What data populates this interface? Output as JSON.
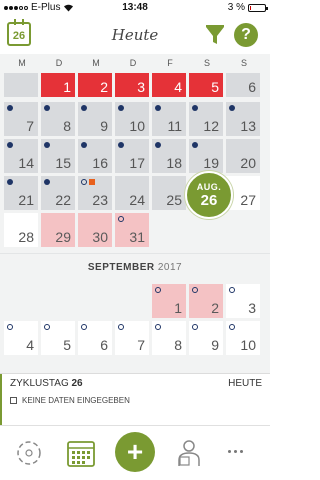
{
  "status_bar": {
    "carrier": "E-Plus",
    "time": "13:48",
    "battery": "3 %"
  },
  "header": {
    "calendar_day": "26",
    "title": "Heute"
  },
  "weekdays": [
    "M",
    "D",
    "M",
    "D",
    "F",
    "S",
    "S"
  ],
  "today_bubble": {
    "month": "AUG.",
    "day": "26"
  },
  "month_label": {
    "month": "SEPTEMBER",
    "year": "2017"
  },
  "info": {
    "cycle_label": "ZYKLUSTAG",
    "cycle_day": "26",
    "today_label": "HEUTE",
    "no_data": "KEINE DATEN EINGEGEBEN"
  },
  "nav": {
    "plus_label": "+"
  },
  "colors": {
    "accent": "#7a9a32",
    "period": "#e53238",
    "predicted": "#f4c2c4",
    "dot": "#1f3566",
    "symptom": "#e8601c"
  },
  "calendar_rows": [
    [
      {
        "col": 0,
        "num": "",
        "bg": "grey",
        "dot": "none"
      },
      {
        "col": 1,
        "num": "1",
        "bg": "red",
        "dot": "none"
      },
      {
        "col": 2,
        "num": "2",
        "bg": "red",
        "dot": "none"
      },
      {
        "col": 3,
        "num": "3",
        "bg": "red",
        "dot": "none"
      },
      {
        "col": 4,
        "num": "4",
        "bg": "red",
        "dot": "none"
      },
      {
        "col": 5,
        "num": "5",
        "bg": "red",
        "dot": "none"
      },
      {
        "col": 6,
        "num": "6",
        "bg": "grey",
        "dot": "none"
      }
    ],
    [
      {
        "col": 0,
        "num": "7",
        "bg": "grey",
        "dot": "filled"
      },
      {
        "col": 1,
        "num": "8",
        "bg": "grey",
        "dot": "filled"
      },
      {
        "col": 2,
        "num": "9",
        "bg": "grey",
        "dot": "filled"
      },
      {
        "col": 3,
        "num": "10",
        "bg": "grey",
        "dot": "filled"
      },
      {
        "col": 4,
        "num": "11",
        "bg": "grey",
        "dot": "filled"
      },
      {
        "col": 5,
        "num": "12",
        "bg": "grey",
        "dot": "filled"
      },
      {
        "col": 6,
        "num": "13",
        "bg": "grey",
        "dot": "filled"
      }
    ],
    [
      {
        "col": 0,
        "num": "14",
        "bg": "grey",
        "dot": "filled"
      },
      {
        "col": 1,
        "num": "15",
        "bg": "grey",
        "dot": "filled"
      },
      {
        "col": 2,
        "num": "16",
        "bg": "grey",
        "dot": "filled"
      },
      {
        "col": 3,
        "num": "17",
        "bg": "grey",
        "dot": "filled"
      },
      {
        "col": 4,
        "num": "18",
        "bg": "grey",
        "dot": "filled"
      },
      {
        "col": 5,
        "num": "19",
        "bg": "grey",
        "dot": "filled"
      },
      {
        "col": 6,
        "num": "20",
        "bg": "grey",
        "dot": "none"
      }
    ],
    [
      {
        "col": 0,
        "num": "21",
        "bg": "grey",
        "dot": "filled"
      },
      {
        "col": 1,
        "num": "22",
        "bg": "grey",
        "dot": "filled"
      },
      {
        "col": 2,
        "num": "23",
        "bg": "grey",
        "dot": "ring",
        "symptom": true
      },
      {
        "col": 3,
        "num": "24",
        "bg": "grey",
        "dot": "none"
      },
      {
        "col": 4,
        "num": "25",
        "bg": "grey",
        "dot": "none"
      },
      {
        "col": 6,
        "num": "27",
        "bg": "white",
        "dot": "none"
      }
    ],
    [
      {
        "col": 0,
        "num": "28",
        "bg": "white",
        "dot": "none"
      },
      {
        "col": 1,
        "num": "29",
        "bg": "pink",
        "dot": "none"
      },
      {
        "col": 2,
        "num": "30",
        "bg": "pink",
        "dot": "none"
      },
      {
        "col": 3,
        "num": "31",
        "bg": "pink",
        "dot": "ring"
      }
    ],
    [
      {
        "col": 4,
        "num": "1",
        "bg": "pink",
        "dot": "ring"
      },
      {
        "col": 5,
        "num": "2",
        "bg": "pink",
        "dot": "ring"
      },
      {
        "col": 6,
        "num": "3",
        "bg": "white",
        "dot": "ring"
      }
    ],
    [
      {
        "col": 0,
        "num": "4",
        "bg": "white",
        "dot": "ring"
      },
      {
        "col": 1,
        "num": "5",
        "bg": "white",
        "dot": "ring"
      },
      {
        "col": 2,
        "num": "6",
        "bg": "white",
        "dot": "ring"
      },
      {
        "col": 3,
        "num": "7",
        "bg": "white",
        "dot": "ring"
      },
      {
        "col": 4,
        "num": "8",
        "bg": "white",
        "dot": "ring"
      },
      {
        "col": 5,
        "num": "9",
        "bg": "white",
        "dot": "ring"
      },
      {
        "col": 6,
        "num": "10",
        "bg": "white",
        "dot": "ring"
      }
    ]
  ]
}
